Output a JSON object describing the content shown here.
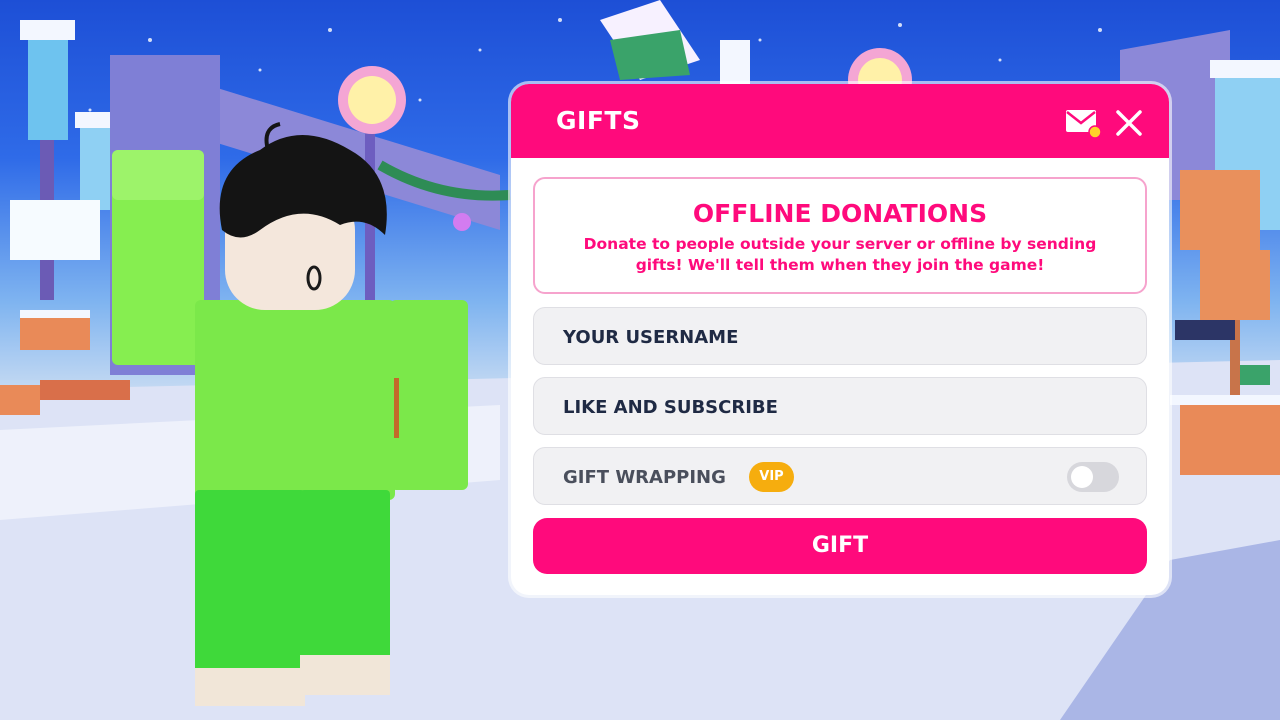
{
  "gifts_panel": {
    "title": "GIFTS",
    "icons": {
      "mail": "mail-icon",
      "notification": "notification-dot",
      "close": "close-icon"
    },
    "info": {
      "heading": "OFFLINE DONATIONS",
      "description": "Donate to people outside your server or offline by sending gifts! We'll tell them when they join the game!"
    },
    "username_field": {
      "value": "YOUR USERNAME"
    },
    "message_field": {
      "value": "LIKE AND SUBSCRIBE"
    },
    "gift_wrapping": {
      "label": "GIFT WRAPPING",
      "badge": "VIP",
      "enabled": false
    },
    "gift_button": {
      "label": "GIFT"
    }
  },
  "colors": {
    "accent": "#ff0a7c",
    "vip_badge": "#f6ad0e",
    "field_bg": "#f1f1f3",
    "avatar_shirt": "#7be84a",
    "avatar_pants": "#3fd93a"
  }
}
